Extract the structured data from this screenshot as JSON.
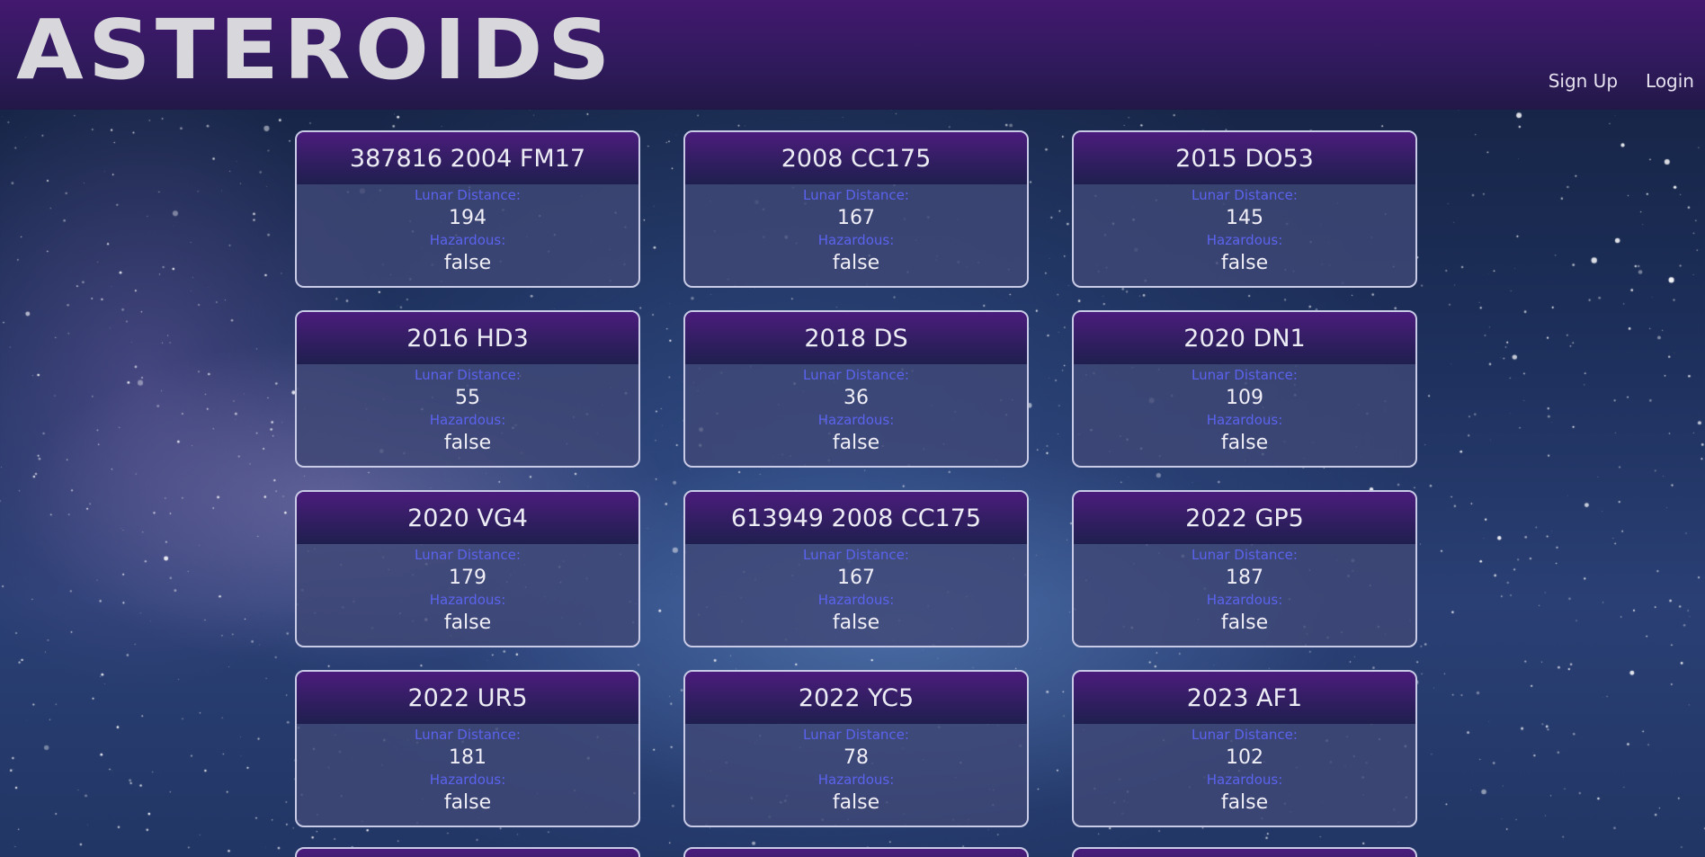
{
  "header": {
    "logo": "ASTEROIDS",
    "nav": {
      "signup": "Sign Up",
      "login": "Login"
    }
  },
  "labels": {
    "distance": "Lunar Distance:",
    "hazardous": "Hazardous:"
  },
  "asteroids": [
    {
      "name": "387816 2004 FM17",
      "distance": "194",
      "hazardous": "false"
    },
    {
      "name": "2008 CC175",
      "distance": "167",
      "hazardous": "false"
    },
    {
      "name": "2015 DO53",
      "distance": "145",
      "hazardous": "false"
    },
    {
      "name": "2016 HD3",
      "distance": "55",
      "hazardous": "false"
    },
    {
      "name": "2018 DS",
      "distance": "36",
      "hazardous": "false"
    },
    {
      "name": "2020 DN1",
      "distance": "109",
      "hazardous": "false"
    },
    {
      "name": "2020 VG4",
      "distance": "179",
      "hazardous": "false"
    },
    {
      "name": "613949 2008 CC175",
      "distance": "167",
      "hazardous": "false"
    },
    {
      "name": "2022 GP5",
      "distance": "187",
      "hazardous": "false"
    },
    {
      "name": "2022 UR5",
      "distance": "181",
      "hazardous": "false"
    },
    {
      "name": "2022 YC5",
      "distance": "78",
      "hazardous": "false"
    },
    {
      "name": "2023 AF1",
      "distance": "102",
      "hazardous": "false"
    }
  ],
  "colors": {
    "header": "#311a5e",
    "card_label": "#5b63ee",
    "card_border": "#c9cbe6"
  }
}
